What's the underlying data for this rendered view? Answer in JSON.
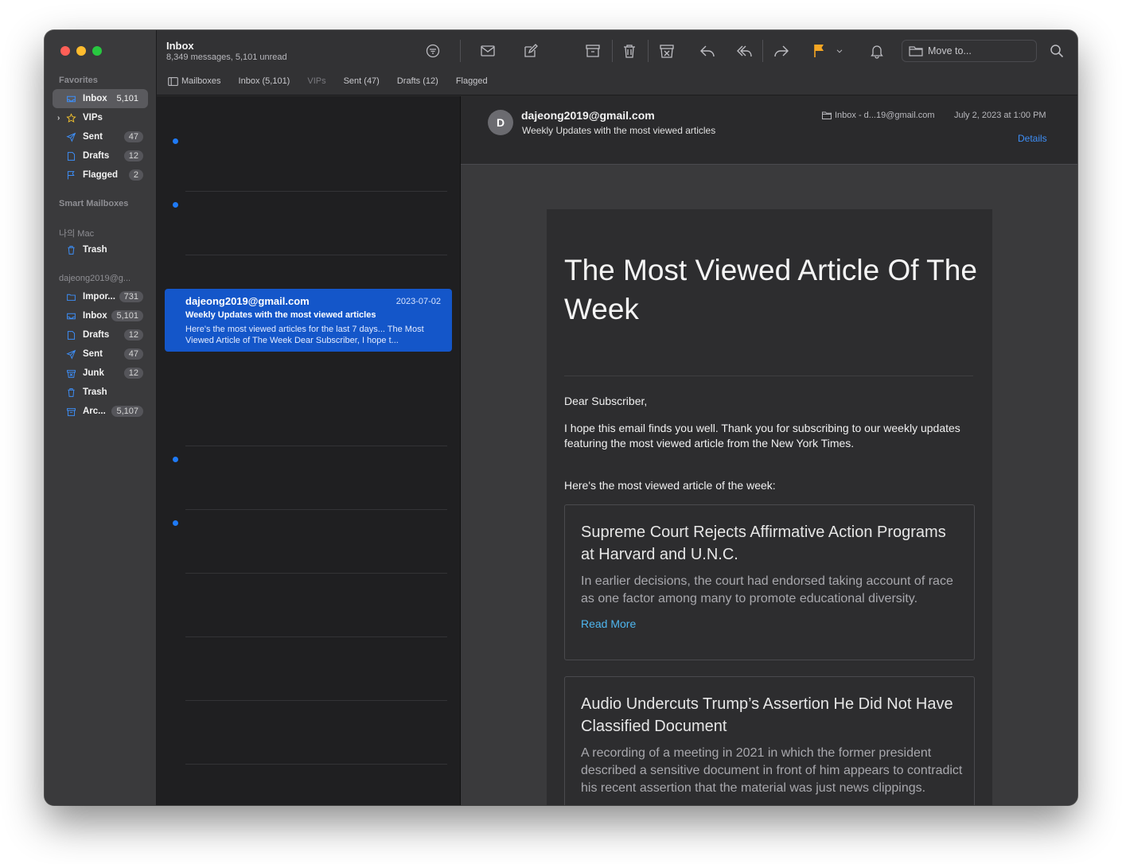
{
  "sidebar": {
    "favorites_header": "Favorites",
    "favorites": [
      {
        "label": "Inbox",
        "count": "5,101",
        "icon": "inbox-icon"
      },
      {
        "label": "VIPs",
        "count": "",
        "icon": "star-icon"
      },
      {
        "label": "Sent",
        "count": "47",
        "icon": "paperplane-icon"
      },
      {
        "label": "Drafts",
        "count": "12",
        "icon": "doc-icon"
      },
      {
        "label": "Flagged",
        "count": "2",
        "icon": "flag-icon"
      }
    ],
    "smart_header": "Smart Mailboxes",
    "mac_header": "나의 Mac",
    "mac_items": [
      {
        "label": "Trash",
        "icon": "trash-icon"
      }
    ],
    "account_header": "dajeong2019@g...",
    "account_items": [
      {
        "label": "Impor...",
        "count": "731",
        "icon": "folder-icon"
      },
      {
        "label": "Inbox",
        "count": "5,101",
        "icon": "inbox-icon"
      },
      {
        "label": "Drafts",
        "count": "12",
        "icon": "doc-icon"
      },
      {
        "label": "Sent",
        "count": "47",
        "icon": "paperplane-icon"
      },
      {
        "label": "Junk",
        "count": "12",
        "icon": "junk-icon"
      },
      {
        "label": "Trash",
        "count": "",
        "icon": "trash-icon"
      },
      {
        "label": "Arc...",
        "count": "5,107",
        "icon": "archive-icon"
      }
    ]
  },
  "toolbar": {
    "title": "Inbox",
    "subtitle": "8,349 messages, 5,101 unread",
    "move_to": "Move to..."
  },
  "favbar": {
    "mailboxes": "Mailboxes",
    "inbox": "Inbox (5,101)",
    "vips": "VIPs",
    "sent": "Sent (47)",
    "drafts": "Drafts (12)",
    "flagged": "Flagged"
  },
  "list": {
    "selected": {
      "from": "dajeong2019@gmail.com",
      "date": "2023-07-02",
      "subject": "Weekly Updates with the most viewed articles",
      "preview": "Here's the most viewed articles for the last 7 days... The Most Viewed Article of The Week Dear Subscriber, I hope t..."
    }
  },
  "message": {
    "avatar": "D",
    "from": "dajeong2019@gmail.com",
    "subject": "Weekly Updates with the most viewed articles",
    "mailbox": "Inbox - d...19@gmail.com",
    "date": "July 2, 2023 at 1:00 PM",
    "details": "Details",
    "body": {
      "heading": "The Most Viewed Article Of The Week",
      "greeting": "Dear Subscriber,",
      "intro": "I hope this email finds you well. Thank you for subscribing to our weekly updates featuring the most viewed article from the New York Times.",
      "lead": "Here's the most viewed article of the week:",
      "articles": [
        {
          "title": "Supreme Court Rejects Affirmative Action Programs at Harvard and U.N.C.",
          "desc": "In earlier decisions, the court had endorsed taking account of race as one factor among many to promote educational diversity.",
          "link": "Read More"
        },
        {
          "title": "Audio Undercuts Trump’s Assertion He Did Not Have Classified Document",
          "desc": "A recording of a meeting in 2021 in which the former president described a sensitive document in front of him appears to contradict his recent assertion that the material was just news clippings."
        }
      ]
    }
  },
  "colors": {
    "accent": "#1456c9",
    "flag": "#f5a623",
    "unread_dot": "#1f7af6",
    "link": "#4fb6ef"
  }
}
